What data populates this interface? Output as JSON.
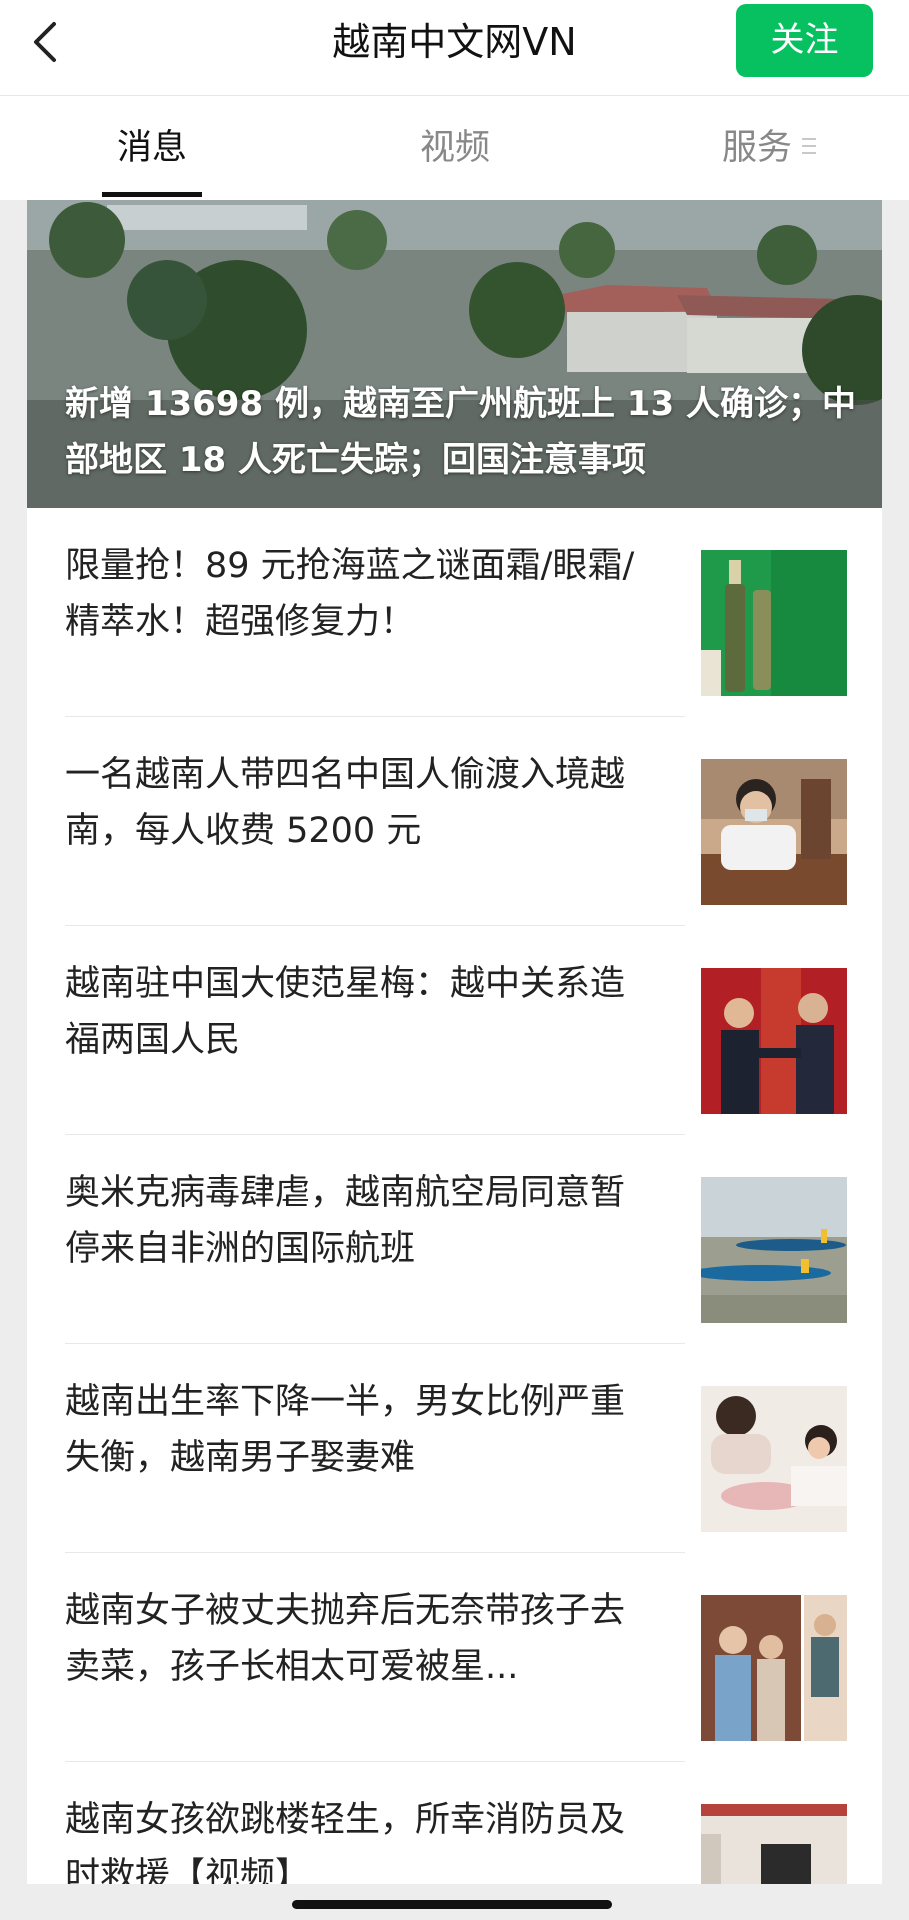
{
  "header": {
    "title": "越南中文网VN",
    "follow_label": "关注",
    "accent_color": "#07c160",
    "back_icon": "chevron-left-icon"
  },
  "tabs": [
    {
      "label": "消息",
      "active": true
    },
    {
      "label": "视频",
      "active": false
    },
    {
      "label": "服务",
      "active": false,
      "icon": "menu-icon"
    }
  ],
  "hero": {
    "headline": "新增 13698 例，越南至广州航班上 13 人确诊；中部地区 18 人死亡失踪；回国注意事项"
  },
  "articles": [
    {
      "title": "限量抢！89 元抢海蓝之谜面霜/眼霜/精萃水！超强修复力！"
    },
    {
      "title": "一名越南人带四名中国人偷渡入境越南，每人收费 5200 元"
    },
    {
      "title": "越南驻中国大使范星梅：越中关系造福两国人民"
    },
    {
      "title": "奥米克病毒肆虐，越南航空局同意暂停来自非洲的国际航班"
    },
    {
      "title": "越南出生率下降一半，男女比例严重失衡，越南男子娶妻难"
    },
    {
      "title": "越南女子被丈夫抛弃后无奈带孩子去卖菜，孩子长相太可爱被星..."
    },
    {
      "title": "越南女孩欲跳楼轻生，所幸消防员及时救援【视频】"
    }
  ]
}
